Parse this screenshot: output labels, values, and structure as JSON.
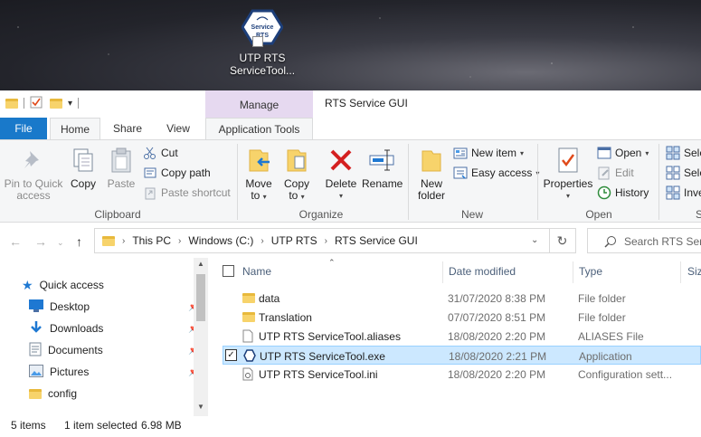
{
  "desktop": {
    "icon_label_line1": "UTP RTS",
    "icon_label_line2": "ServiceTool...",
    "icon_badge_line1": "Service",
    "icon_badge_line2": "RTS"
  },
  "titlebar": {
    "contextual_tab": "Manage",
    "window_title": "RTS Service GUI"
  },
  "ribbon_tabs": {
    "file": "File",
    "home": "Home",
    "share": "Share",
    "view": "View",
    "app_tools": "Application Tools"
  },
  "ribbon": {
    "clipboard": {
      "group_label": "Clipboard",
      "pin_line1": "Pin to Quick",
      "pin_line2": "access",
      "copy": "Copy",
      "paste": "Paste",
      "cut": "Cut",
      "copy_path": "Copy path",
      "paste_shortcut": "Paste shortcut"
    },
    "organize": {
      "group_label": "Organize",
      "move_line1": "Move",
      "move_line2": "to",
      "copy_line1": "Copy",
      "copy_line2": "to",
      "delete": "Delete",
      "rename": "Rename"
    },
    "new": {
      "group_label": "New",
      "new_folder_line1": "New",
      "new_folder_line2": "folder",
      "new_item": "New item",
      "easy_access": "Easy access"
    },
    "open": {
      "group_label": "Open",
      "properties": "Properties",
      "open": "Open",
      "edit": "Edit",
      "history": "History"
    },
    "select": {
      "select_all": "Sele",
      "select_none": "Sele",
      "invert": "Inve",
      "group_label": "S"
    }
  },
  "address": {
    "crumbs": [
      "This PC",
      "Windows (C:)",
      "UTP RTS",
      "RTS Service GUI"
    ],
    "search_placeholder": "Search RTS Servi"
  },
  "navpane": {
    "items": [
      {
        "label": "Quick access",
        "icon": "star-icon",
        "pinned": false
      },
      {
        "label": "Desktop",
        "icon": "desktop-icon",
        "pinned": true
      },
      {
        "label": "Downloads",
        "icon": "download-icon",
        "pinned": true
      },
      {
        "label": "Documents",
        "icon": "document-icon",
        "pinned": true
      },
      {
        "label": "Pictures",
        "icon": "picture-icon",
        "pinned": true
      },
      {
        "label": "config",
        "icon": "folder-icon",
        "pinned": false
      }
    ]
  },
  "filelist": {
    "columns": {
      "name": "Name",
      "date": "Date modified",
      "type": "Type",
      "size": "Siz"
    },
    "rows": [
      {
        "name": "data",
        "date": "31/07/2020 8:38 PM",
        "type": "File folder",
        "icon": "folder-icon",
        "selected": false
      },
      {
        "name": "Translation",
        "date": "07/07/2020 8:51 PM",
        "type": "File folder",
        "icon": "folder-icon",
        "selected": false
      },
      {
        "name": "UTP RTS ServiceTool.aliases",
        "date": "18/08/2020 2:20 PM",
        "type": "ALIASES File",
        "icon": "file-icon",
        "selected": false
      },
      {
        "name": "UTP RTS ServiceTool.exe",
        "date": "18/08/2020 2:21 PM",
        "type": "Application",
        "icon": "app-icon",
        "selected": true
      },
      {
        "name": "UTP RTS ServiceTool.ini",
        "date": "18/08/2020 2:20 PM",
        "type": "Configuration sett...",
        "icon": "settings-file-icon",
        "selected": false
      }
    ]
  },
  "statusbar": {
    "item_count": "5 items",
    "selection": "1 item selected",
    "size": "6.98 MB"
  },
  "colors": {
    "accent": "#1979ca",
    "manage_tab": "#e6d9f0",
    "selection_bg": "#cce8ff",
    "folder": "#f7d36b"
  }
}
